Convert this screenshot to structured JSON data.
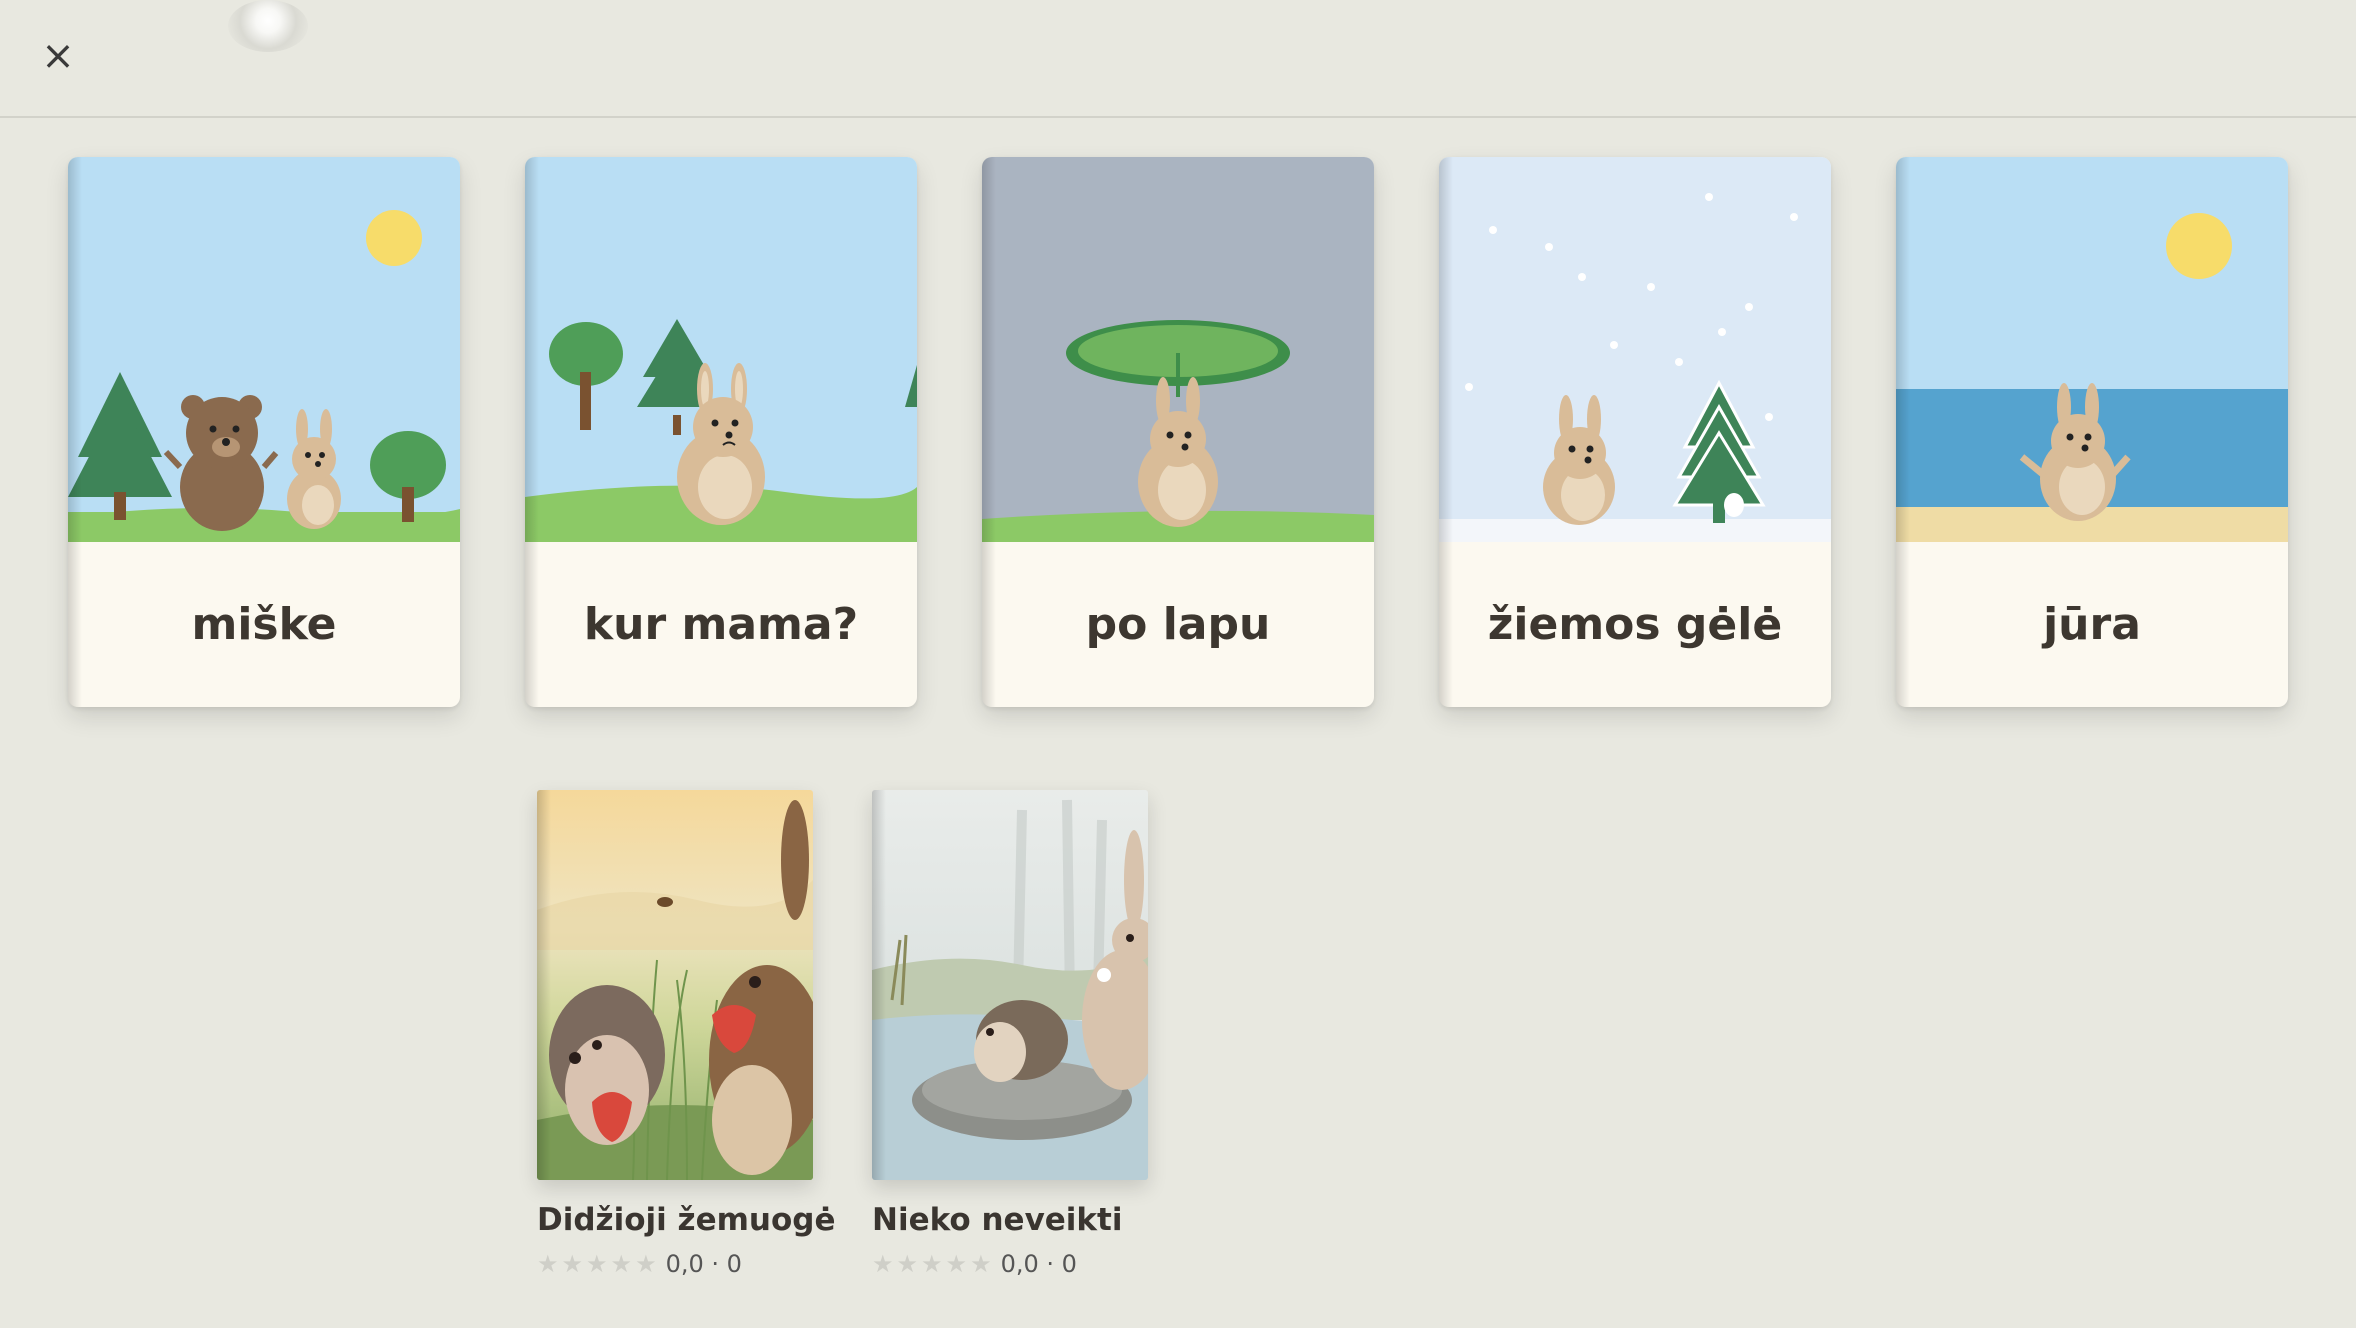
{
  "header": {
    "close_icon": "×"
  },
  "books": [
    {
      "title": "miške",
      "scene": "forest-bear-bunny"
    },
    {
      "title": "kur mama?",
      "scene": "bunny-looking-for-mama"
    },
    {
      "title": "po lapu",
      "scene": "bunny-under-leaf"
    },
    {
      "title": "žiemos gėlė",
      "scene": "winter-snow"
    },
    {
      "title": "jūra",
      "scene": "sea-beach"
    }
  ],
  "stories": [
    {
      "title": "Didžioji žemuogė",
      "stars": "★★★★★",
      "rating": "0,0 · 0"
    },
    {
      "title": "Nieko neveikti",
      "stars": "★★★★★",
      "rating": "0,0 · 0"
    }
  ],
  "colors": {
    "background": "#e8e8e0",
    "sky": "#b9def4",
    "grass": "#8cc966",
    "card": "#fcf9f0"
  }
}
